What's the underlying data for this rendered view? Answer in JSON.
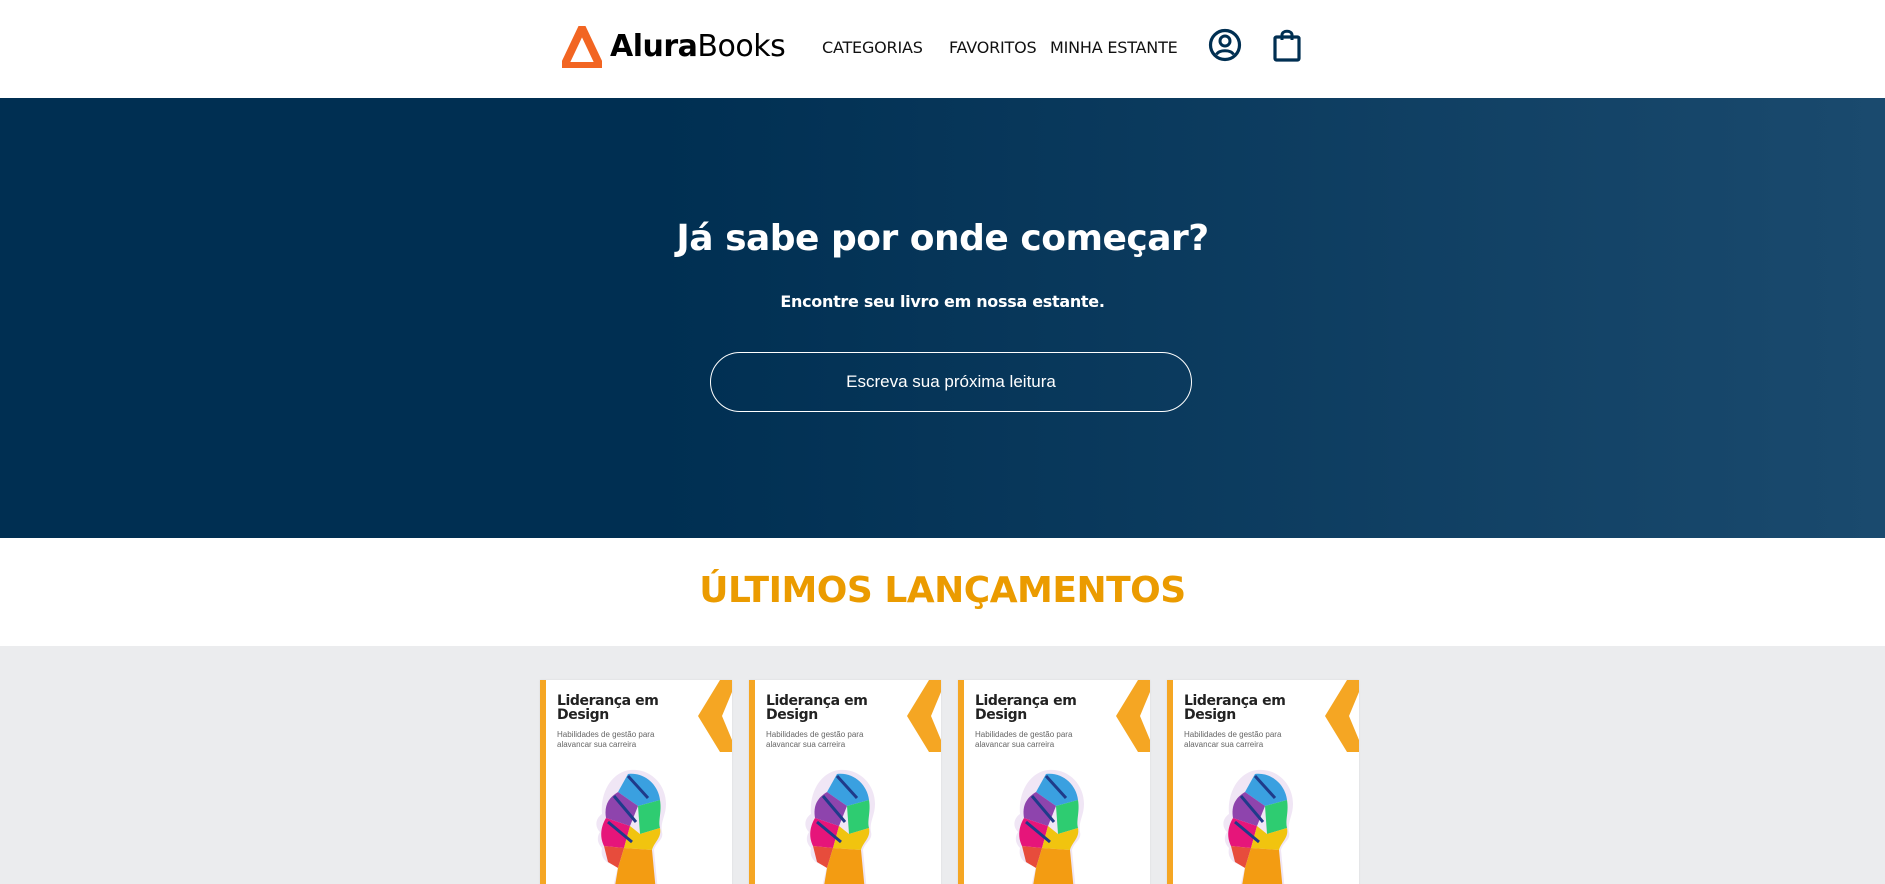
{
  "header": {
    "logo": {
      "bold": "Alura",
      "regular": "Books"
    },
    "nav": [
      {
        "label": "CATEGORIAS"
      },
      {
        "label": "FAVORITOS"
      },
      {
        "label": "MINHA ESTANTE"
      }
    ],
    "icons": [
      "user-profile-icon",
      "shopping-bag-icon"
    ]
  },
  "hero": {
    "title": "Já sabe por onde começar?",
    "subtitle": "Encontre seu livro em nossa estante.",
    "search_placeholder": "Escreva sua próxima leitura",
    "search_value": ""
  },
  "launches": {
    "title": "ÚLTIMOS LANÇAMENTOS",
    "books": [
      {
        "title": "Liderança em Design",
        "subtitle": "Habilidades de gestão para alavancar sua carreira"
      },
      {
        "title": "Liderança em Design",
        "subtitle": "Habilidades de gestão para alavancar sua carreira"
      },
      {
        "title": "Liderança em Design",
        "subtitle": "Habilidades de gestão para alavancar sua carreira"
      },
      {
        "title": "Liderança em Design",
        "subtitle": "Habilidades de gestão para alavancar sua carreira"
      }
    ]
  },
  "colors": {
    "brand_orange": "#f26522",
    "hero_dark": "#002f52",
    "section_title": "#eb9b00",
    "shelf_bg": "#ebecee",
    "icon_navy": "#002f52"
  }
}
